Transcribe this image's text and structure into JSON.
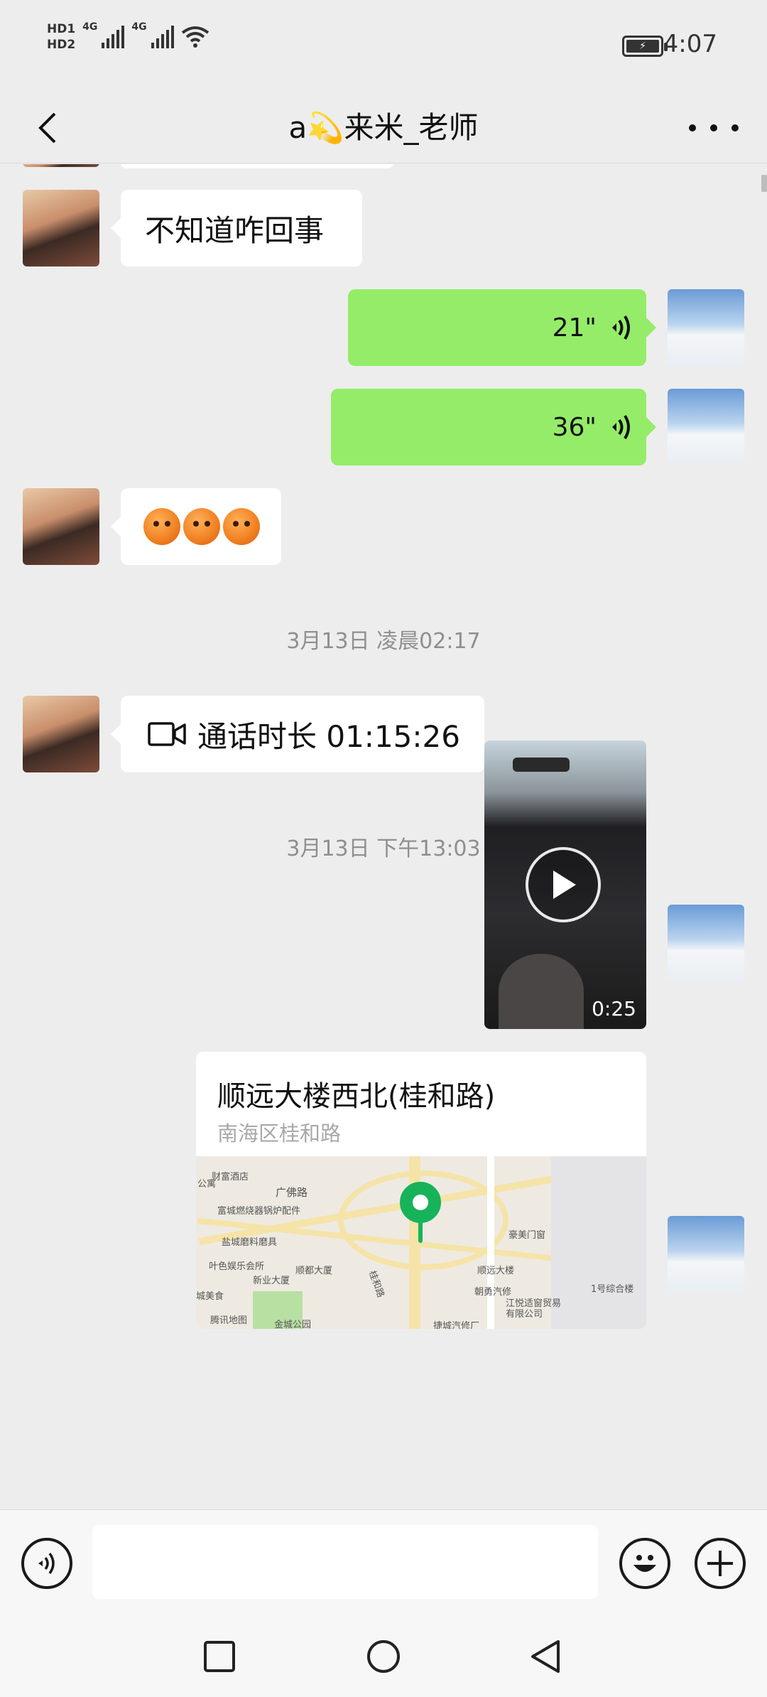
{
  "status_bar": {
    "hd1": "HD1",
    "hd2": "HD2",
    "net1": "4G",
    "net2": "4G",
    "time": "4:07"
  },
  "header": {
    "title": "a💫来米_老师"
  },
  "messages": {
    "text1": "不知道咋回事",
    "voice1_duration": "21\"",
    "voice2_duration": "36\"",
    "timestamp1": "3月13日 凌晨02:17",
    "video_call_label": "通话时长 01:15:26",
    "timestamp2": "3月13日 下午13:03",
    "video_duration": "0:25",
    "location_name": "顺远大楼西北(桂和路)",
    "location_address": "南海区桂和路",
    "map_labels": {
      "road1": "广佛路",
      "poi1": "财富酒店",
      "poi2": "富城燃烧器锅炉配件",
      "poi3": "盐城磨料磨具",
      "poi4": "叶色娱乐会所",
      "poi5": "新业大厦",
      "poi6": "顺都大厦",
      "poi7": "豪美门窗",
      "poi8": "顺远大楼",
      "poi9": "朝勇汽修",
      "poi10": "1号综合楼",
      "poi11": "江悦适窗贸易有限公司",
      "poi12": "金城公园",
      "poi13": "捷城汽修厂",
      "road2": "桂和路",
      "poi14": "城美食",
      "poi15": "公寓"
    },
    "map_credit": "腾讯地图"
  },
  "colors": {
    "sent_bubble": "#95ec69",
    "received_bubble": "#ffffff",
    "background": "#ededed",
    "map_pin": "#17b35a"
  }
}
